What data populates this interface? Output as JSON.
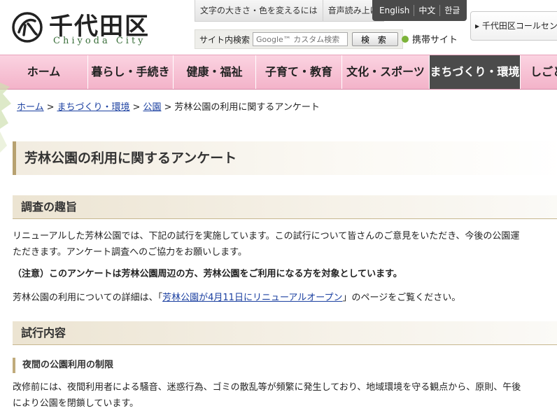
{
  "header": {
    "logo_ja": "千代田区",
    "logo_en": "Chiyoda City",
    "util": [
      "文字の大きさ・色を変えるには",
      "音声読み上げ"
    ],
    "lang": [
      "English",
      "中文",
      "한글"
    ],
    "search": {
      "label": "サイト内検索",
      "placeholder": "Google™ カスタム検索",
      "button": "検 索"
    },
    "mobile": "携帯サイト",
    "callcenter": "▸ 千代田区コールセンター"
  },
  "nav": [
    {
      "label": "ホーム",
      "active": false
    },
    {
      "label": "暮らし・手続き",
      "active": false
    },
    {
      "label": "健康・福祉",
      "active": false
    },
    {
      "label": "子育て・教育",
      "active": false
    },
    {
      "label": "文化・スポーツ",
      "active": false
    },
    {
      "label": "まちづくり・環境",
      "active": true
    },
    {
      "label": "しごと",
      "active": false
    }
  ],
  "breadcrumb": {
    "items": [
      "ホーム",
      "まちづくり・環境",
      "公園"
    ],
    "current": "芳林公園の利用に関するアンケート",
    "separator": ">"
  },
  "page_title": "芳林公園の利用に関するアンケート",
  "sections": {
    "purpose_heading": "調査の趣旨",
    "purpose_p1_line1": "リニューアルした芳林公園では、下記の試行を実施しています。この試行について皆さんのご意見をいただき、今後の公園運",
    "purpose_p1_line2": "ただきます。アンケート調査へのご協力をお願いします。",
    "notice": "（注意）このアンケートは芳林公園周辺の方、芳林公園をご利用になる方を対象としています。",
    "detail_prefix": "芳林公園の利用についての詳細は、「",
    "detail_link": "芳林公園が4月11日にリニューアルオープン",
    "detail_suffix": "」のページをご覧ください。",
    "trial_heading": "試行内容",
    "night_heading": "夜間の公園利用の制限",
    "night_line1": "改修前には、夜間利用者による騒音、迷惑行為、ゴミの散乱等が頻繁に発生しており、地域環境を守る観点から、原則、午後",
    "night_line2": "により公園を閉鎖しています。"
  }
}
